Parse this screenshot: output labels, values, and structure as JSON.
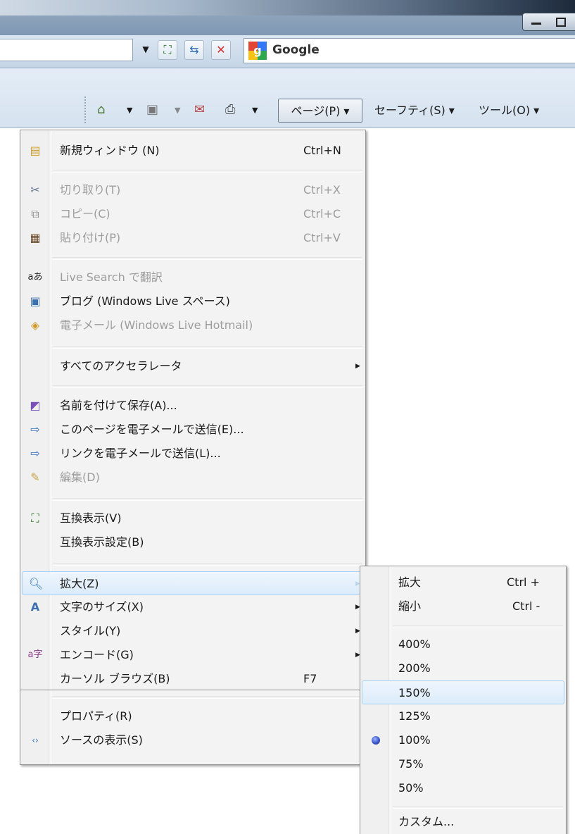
{
  "toolbar": {
    "search_provider": "Google",
    "address_dropdown_icon": "chevron-down-icon",
    "nav_icons": [
      "compatibility-view-icon",
      "refresh-icon",
      "stop-icon"
    ],
    "command": {
      "icons": [
        "home-icon",
        "feeds-icon",
        "read-mail-icon",
        "print-icon"
      ],
      "page_label": "ページ(P) ▾",
      "safety_label": "セーフティ(S) ▾",
      "tools_label": "ツール(O) ▾"
    }
  },
  "page_menu": {
    "items": [
      {
        "label": "新規ウィンドウ (N)",
        "shortcut": "Ctrl+N",
        "icon": "new-window-icon",
        "enabled": true
      },
      {
        "label": "切り取り(T)",
        "shortcut": "Ctrl+X",
        "icon": "scissors-icon",
        "enabled": false
      },
      {
        "label": "コピー(C)",
        "shortcut": "Ctrl+C",
        "icon": "copy-icon",
        "enabled": false
      },
      {
        "label": "貼り付け(P)",
        "shortcut": "Ctrl+V",
        "icon": "paste-icon",
        "enabled": false
      },
      {
        "label": "Live Search で翻訳",
        "icon": "translate-icon",
        "enabled": false
      },
      {
        "label": "ブログ (Windows Live スペース)",
        "icon": "blog-icon",
        "enabled": true
      },
      {
        "label": "電子メール (Windows Live Hotmail)",
        "icon": "email-icon",
        "enabled": false
      },
      {
        "label": "すべてのアクセラレータ",
        "submenu": true,
        "enabled": true
      },
      {
        "label": "名前を付けて保存(A)...",
        "icon": "save-icon",
        "enabled": true
      },
      {
        "label": "このページを電子メールで送信(E)...",
        "icon": "send-page-icon",
        "enabled": true
      },
      {
        "label": "リンクを電子メールで送信(L)...",
        "icon": "send-link-icon",
        "enabled": true
      },
      {
        "label": "編集(D)",
        "icon": "pencil-icon",
        "enabled": false
      },
      {
        "label": "互換表示(V)",
        "icon": "compatibility-view-icon",
        "enabled": true
      },
      {
        "label": "互換表示設定(B)",
        "enabled": true
      },
      {
        "label": "拡大(Z)",
        "icon": "zoom-icon",
        "submenu": true,
        "highlighted": true,
        "enabled": true
      },
      {
        "label": "文字のサイズ(X)",
        "icon": "text-size-icon",
        "submenu": true,
        "enabled": true
      },
      {
        "label": "スタイル(Y)",
        "submenu": true,
        "enabled": true
      },
      {
        "label": "エンコード(G)",
        "icon": "encoding-icon",
        "submenu": true,
        "enabled": true
      },
      {
        "label": "カーソル ブラウズ(B)",
        "shortcut": "F7",
        "enabled": true
      },
      {
        "label": "プロパティ(R)",
        "enabled": true
      },
      {
        "label": "ソースの表示(S)",
        "icon": "view-source-icon",
        "enabled": true
      }
    ]
  },
  "zoom_menu": {
    "zoom_in": {
      "label": "拡大",
      "shortcut": "Ctrl +"
    },
    "zoom_out": {
      "label": "縮小",
      "shortcut": "Ctrl -"
    },
    "levels": [
      "400%",
      "200%",
      "150%",
      "125%",
      "100%",
      "75%",
      "50%"
    ],
    "selected": "100%",
    "hovered": "150%",
    "custom": "カスタム..."
  }
}
